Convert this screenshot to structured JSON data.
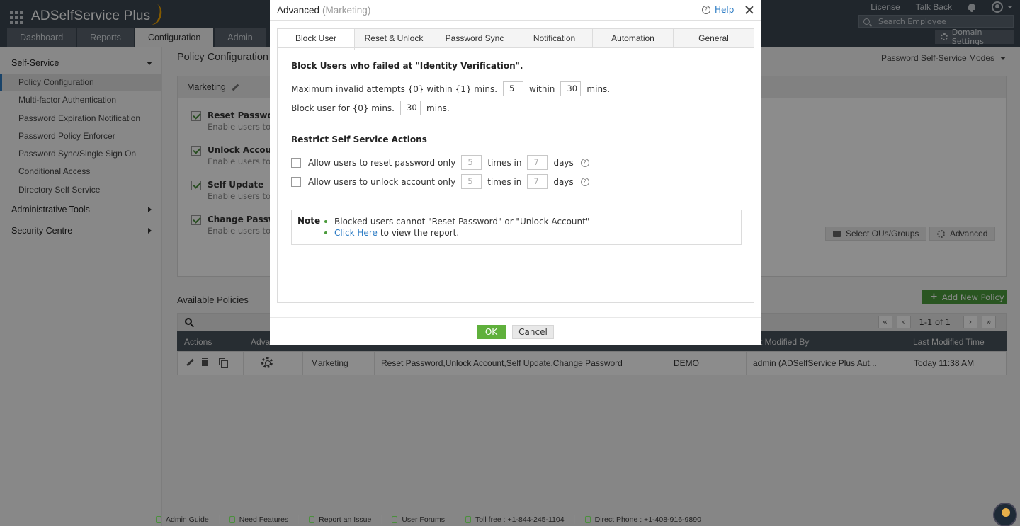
{
  "header": {
    "app_name": "ADSelfService Plus",
    "top_links": [
      "License",
      "Talk Back"
    ],
    "search_placeholder": "Search Employee",
    "nav_tabs": [
      "Dashboard",
      "Reports",
      "Configuration",
      "Admin"
    ],
    "active_tab": "Configuration",
    "domain_settings": "Domain Settings"
  },
  "sidebar": {
    "self_service": "Self-Service",
    "items": [
      "Policy Configuration",
      "Multi-factor Authentication",
      "Password Expiration Notification",
      "Password Policy Enforcer",
      "Password Sync/Single Sign On",
      "Conditional Access",
      "Directory Self Service"
    ],
    "active_item": "Policy Configuration",
    "administrative_tools": "Administrative Tools",
    "security_centre": "Security Centre"
  },
  "main": {
    "page_title": "Policy Configuration",
    "modes_dropdown": "Password Self-Service Modes",
    "policy_name": "Marketing",
    "features": [
      {
        "title": "Reset Password",
        "desc": "Enable users to s"
      },
      {
        "title": "Unlock Account",
        "desc": "Enable users to u"
      },
      {
        "title": "Self Update",
        "desc": "Enable users to s"
      },
      {
        "title": "Change Passwo",
        "desc": "Enable users to c"
      }
    ],
    "select_ous": "Select OUs/Groups",
    "advanced": "Advanced",
    "available_policies": "Available Policies",
    "add_new_policy": "Add New Policy",
    "pager": {
      "first": "«",
      "prev": "‹",
      "text": "1-1 of 1",
      "next": "›",
      "last": "»"
    },
    "columns": [
      "Actions",
      "Adva",
      "st Modified By",
      "Last Modified Time"
    ],
    "row": {
      "policy": "Marketing",
      "features": "Reset Password,Unlock Account,Self Update,Change Password",
      "domain": "DEMO",
      "modified_by": "admin (ADSelfService Plus Aut...",
      "modified_time": "Today 11:38 AM"
    }
  },
  "footer": {
    "items": [
      "Admin Guide",
      "Need Features",
      "Report an Issue",
      "User Forums",
      "Toll free : +1-844-245-1104",
      "Direct Phone : +1-408-916-9890"
    ]
  },
  "modal": {
    "title": "Advanced",
    "subtitle": "(Marketing)",
    "help": "Help",
    "tabs": [
      "Block User",
      "Reset & Unlock",
      "Password Sync",
      "Notification",
      "Automation",
      "General"
    ],
    "active_tab": "Block User",
    "block_title": "Block Users who failed at \"Identity Verification\".",
    "max_attempts_label": "Maximum invalid attempts {0} within {1} mins.",
    "max_attempts_value": "5",
    "within": "within",
    "within_value": "30",
    "mins": "mins.",
    "block_for_label": "Block user for {0} mins.",
    "block_for_value": "30",
    "restrict_title": "Restrict Self Service Actions",
    "reset_only_label": "Allow users to reset password only",
    "reset_times_value": "5",
    "times_in": "times in",
    "reset_days_value": "7",
    "days": "days",
    "unlock_only_label": "Allow users to unlock account only",
    "unlock_times_value": "5",
    "unlock_days_value": "7",
    "note_label": "Note",
    "note_1": "Blocked users cannot \"Reset Password\" or \"Unlock Account\"",
    "note_2_link": "Click Here",
    "note_2_rest": "to view the report.",
    "ok": "OK",
    "cancel": "Cancel"
  }
}
